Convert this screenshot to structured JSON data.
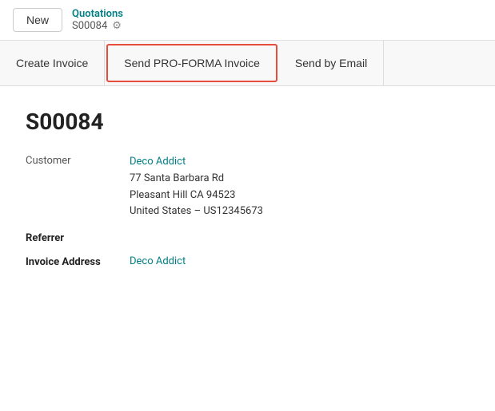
{
  "header": {
    "new_button_label": "New",
    "breadcrumb_title": "Quotations",
    "breadcrumb_record": "S00084"
  },
  "actions": {
    "create_invoice": "Create Invoice",
    "send_proforma": "Send PRO-FORMA Invoice",
    "send_email": "Send by Email"
  },
  "record": {
    "id": "S00084",
    "customer_label": "Customer",
    "customer_name": "Deco Addict",
    "customer_address_line1": "77 Santa Barbara Rd",
    "customer_address_line2": "Pleasant Hill CA 94523",
    "customer_address_line3": "United States – US12345673",
    "referrer_label": "Referrer",
    "referrer_value": "",
    "invoice_address_label": "Invoice Address",
    "invoice_address_value": "Deco Addict"
  },
  "icons": {
    "gear": "⚙"
  }
}
